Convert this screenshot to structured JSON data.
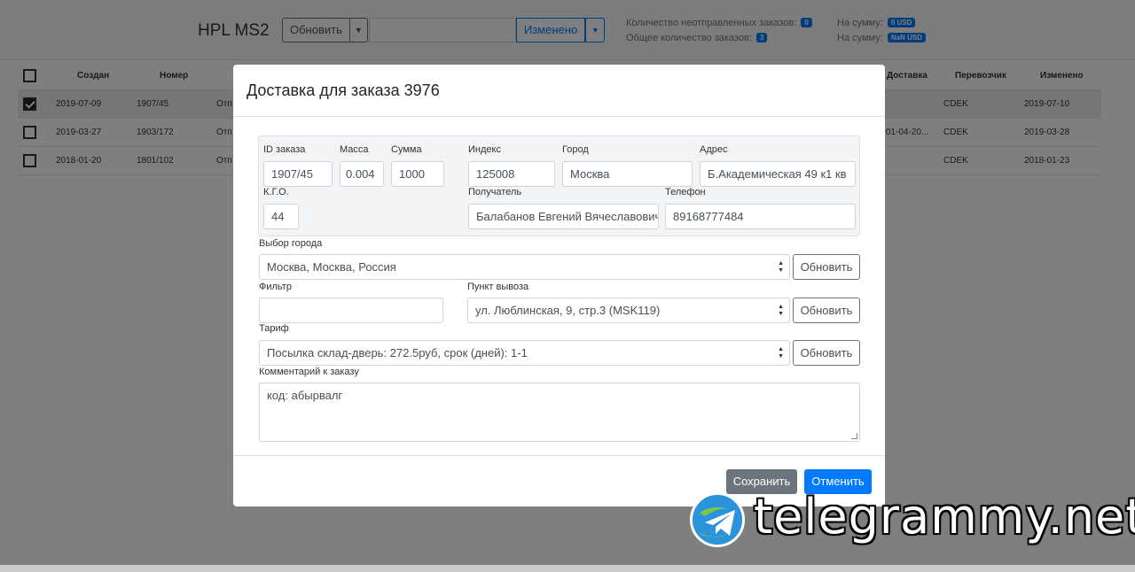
{
  "app": {
    "brand": "HPL MS2",
    "refresh_button": "Обновить",
    "sort_button": "Изменено",
    "stats": {
      "unsent_label": "Количество неотправленных заказов:",
      "unsent_count": "0",
      "unsent_sum_label": "На сумму:",
      "unsent_sum": "0 USD",
      "total_label": "Общее количество заказов:",
      "total_count": "3",
      "total_sum_label": "На сумму:",
      "total_sum": "NaN USD"
    }
  },
  "table": {
    "headers": {
      "created": "Создан",
      "number": "Номер",
      "delivery": "Доставка",
      "carrier": "Перевозчик",
      "changed": "Изменено"
    },
    "rows": [
      {
        "checked": true,
        "created": "2019-07-09",
        "number": "1907/45",
        "status": "Отп",
        "delivery": "",
        "carrier": "CDEK",
        "changed": "2019-07-10"
      },
      {
        "checked": false,
        "created": "2019-03-27",
        "number": "1903/172",
        "status": "Отп",
        "delivery": "ен 01-04-20...",
        "carrier": "CDEK",
        "changed": "2019-03-28"
      },
      {
        "checked": false,
        "created": "2018-01-20",
        "number": "1801/102",
        "status": "Отп",
        "delivery": "",
        "carrier": "CDEK",
        "changed": "2018-01-23"
      }
    ]
  },
  "modal": {
    "title": "Доставка для заказа 3976",
    "fields": {
      "order_id_label": "ID заказа",
      "order_id": "1907/45",
      "mass_label": "Масса",
      "mass": "0.004",
      "sum_label": "Сумма",
      "sum": "1000",
      "index_label": "Индекс",
      "index": "125008",
      "city_label": "Город",
      "city": "Москва",
      "address_label": "Адрес",
      "address": "Б.Академическая 49 к1 кв",
      "kgo_label": "К.Г.О.",
      "kgo": "44",
      "recipient_label": "Получатель",
      "recipient": "Балабанов Евгений Вячеславович",
      "phone_label": "Телефон",
      "phone": "89168777484"
    },
    "city_select_label": "Выбор города",
    "city_select": "Москва, Москва, Россия",
    "filter_label": "Фильтр",
    "filter_value": "",
    "pickup_label": "Пункт вывоза",
    "pickup_select": "ул. Люблинская, 9, стр.3 (MSK119)",
    "tariff_label": "Тариф",
    "tariff_select": "Посылка склад-дверь: 272.5руб, срок (дней): 1-1",
    "comment_label": "Комментарий к заказу",
    "comment": "код: абырвалг",
    "refresh_label": "Обновить",
    "save_button": "Сохранить",
    "cancel_button": "Отменить"
  },
  "watermark": {
    "text": "telegrammy.net"
  },
  "colors": {
    "primary": "#007bff",
    "secondary": "#6c757d",
    "backdrop": "rgba(0,0,0,0.5)"
  }
}
